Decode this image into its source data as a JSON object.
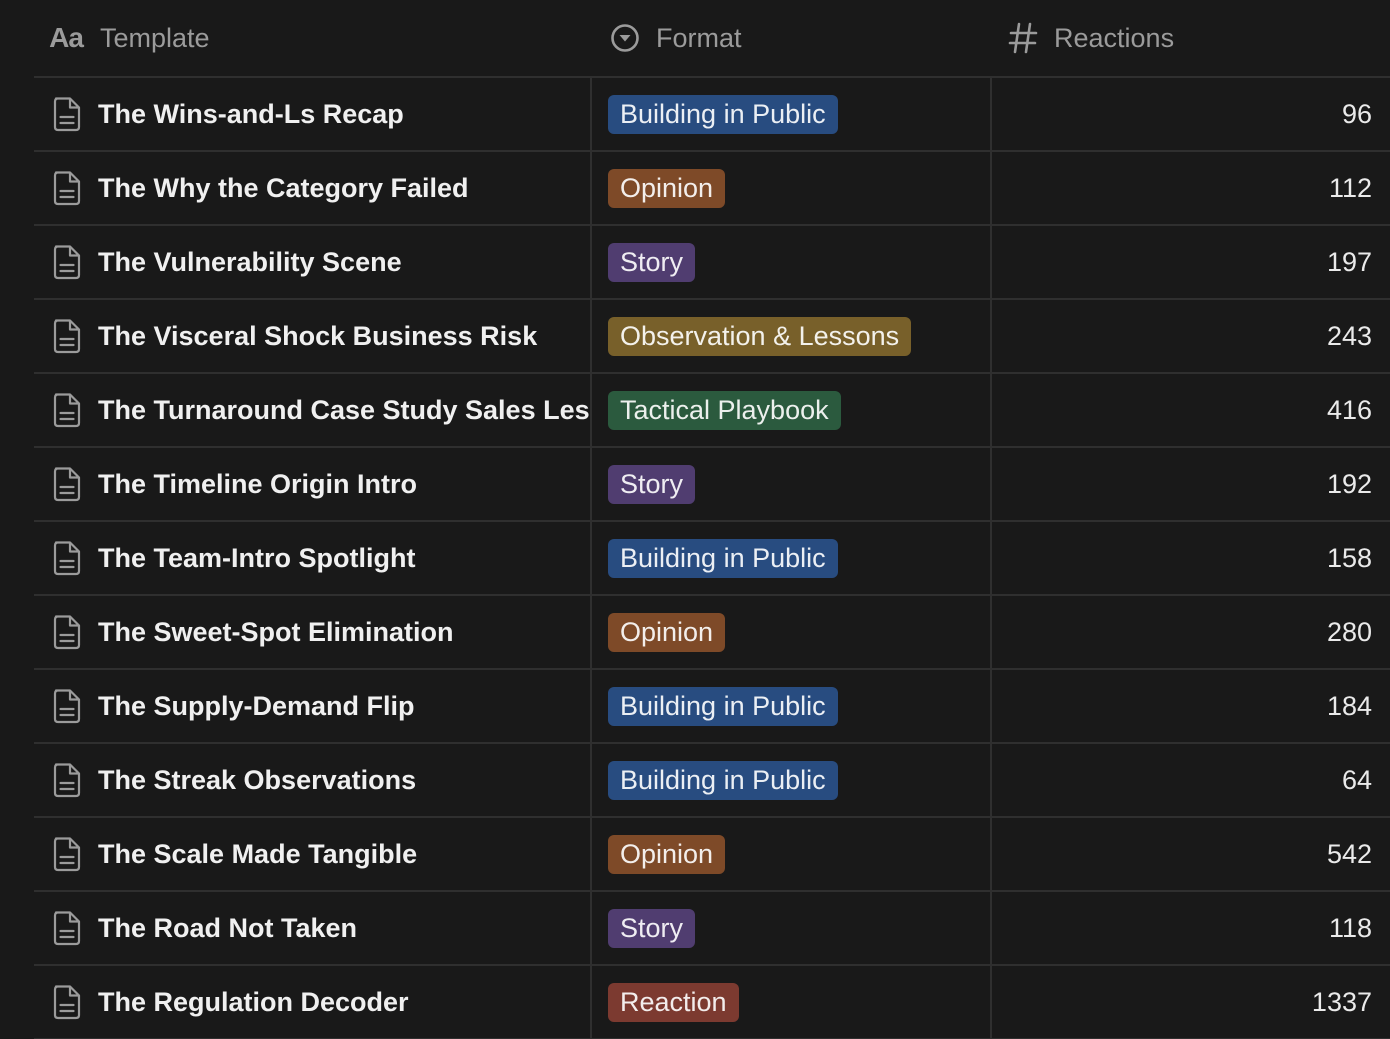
{
  "header": {
    "template_label": "Template",
    "format_label": "Format",
    "reactions_label": "Reactions",
    "template_icon_text": "Aa"
  },
  "colors": {
    "Building in Public": "#284c80",
    "Opinion": "#7e4a28",
    "Story": "#503d70",
    "Observation & Lessons": "#78602a",
    "Tactical Playbook": "#2b5a3e",
    "Reaction": "#7c3a30"
  },
  "rows": [
    {
      "title": "The Wins-and-Ls Recap",
      "format": "Building in Public",
      "tag_color": "blue",
      "reactions": "96"
    },
    {
      "title": "The Why the Category Failed",
      "format": "Opinion",
      "tag_color": "orange",
      "reactions": "112"
    },
    {
      "title": "The Vulnerability Scene",
      "format": "Story",
      "tag_color": "purple",
      "reactions": "197"
    },
    {
      "title": "The Visceral Shock Business Risk",
      "format": "Observation & Lessons",
      "tag_color": "yellow",
      "reactions": "243"
    },
    {
      "title": "The Turnaround Case Study Sales Lessons",
      "format": "Tactical Playbook",
      "tag_color": "green",
      "reactions": "416"
    },
    {
      "title": "The Timeline Origin Intro",
      "format": "Story",
      "tag_color": "purple",
      "reactions": "192"
    },
    {
      "title": "The Team-Intro Spotlight",
      "format": "Building in Public",
      "tag_color": "blue",
      "reactions": "158"
    },
    {
      "title": "The Sweet-Spot Elimination",
      "format": "Opinion",
      "tag_color": "orange",
      "reactions": "280"
    },
    {
      "title": "The Supply-Demand Flip",
      "format": "Building in Public",
      "tag_color": "blue",
      "reactions": "184"
    },
    {
      "title": "The Streak Observations",
      "format": "Building in Public",
      "tag_color": "blue",
      "reactions": "64"
    },
    {
      "title": "The Scale Made Tangible",
      "format": "Opinion",
      "tag_color": "orange",
      "reactions": "542"
    },
    {
      "title": "The Road Not Taken",
      "format": "Story",
      "tag_color": "purple",
      "reactions": "118"
    },
    {
      "title": "The Regulation Decoder",
      "format": "Reaction",
      "tag_color": "red",
      "reactions": "1337"
    }
  ]
}
